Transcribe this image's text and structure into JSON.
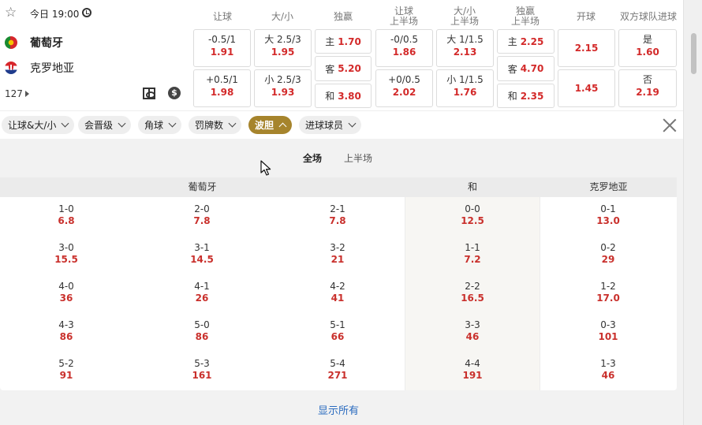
{
  "header": {
    "time": "今日 19:00",
    "more_count": "127"
  },
  "teams": {
    "home": "葡萄牙",
    "away": "克罗地亚"
  },
  "market_headers": [
    "让球",
    "大/小",
    "独赢",
    "让球\n上半场",
    "大/小\n上半场",
    "独赢\n上半场",
    "开球",
    "双方球队进球"
  ],
  "markets": {
    "handicap": [
      {
        "label": "-0.5/1",
        "odds": "1.91"
      },
      {
        "label": "+0.5/1",
        "odds": "1.98"
      }
    ],
    "total": [
      {
        "label": "大 2.5/3",
        "odds": "1.95"
      },
      {
        "label": "小 2.5/3",
        "odds": "1.93"
      }
    ],
    "moneyline": [
      {
        "label": "主",
        "odds": "1.70"
      },
      {
        "label": "客",
        "odds": "5.20"
      },
      {
        "label": "和",
        "odds": "3.80"
      }
    ],
    "handicap_1h": [
      {
        "label": "-0/0.5",
        "odds": "1.86"
      },
      {
        "label": "+0/0.5",
        "odds": "2.02"
      }
    ],
    "total_1h": [
      {
        "label": "大 1/1.5",
        "odds": "2.13"
      },
      {
        "label": "小 1/1.5",
        "odds": "1.76"
      }
    ],
    "moneyline_1h": [
      {
        "label": "主",
        "odds": "2.25"
      },
      {
        "label": "客",
        "odds": "4.70"
      },
      {
        "label": "和",
        "odds": "2.35"
      }
    ],
    "kickoff": [
      "2.15",
      "1.45"
    ],
    "btts": [
      {
        "label": "是",
        "odds": "1.60"
      },
      {
        "label": "否",
        "odds": "2.19"
      }
    ]
  },
  "filters": [
    "让球&大/小",
    "会晋级",
    "角球",
    "罚牌数",
    "波胆",
    "进球球员"
  ],
  "active_filter": "波胆",
  "period_tabs": [
    "全场",
    "上半场"
  ],
  "active_period": "全场",
  "score_grid": {
    "headers": {
      "home": "葡萄牙",
      "draw": "和",
      "away": "克罗地亚"
    },
    "rows": [
      [
        {
          "s": "1-0",
          "o": "6.8"
        },
        {
          "s": "2-0",
          "o": "7.8"
        },
        {
          "s": "2-1",
          "o": "7.8"
        },
        {
          "s": "0-0",
          "o": "12.5"
        },
        {
          "s": "0-1",
          "o": "13.0"
        }
      ],
      [
        {
          "s": "3-0",
          "o": "15.5"
        },
        {
          "s": "3-1",
          "o": "14.5"
        },
        {
          "s": "3-2",
          "o": "21"
        },
        {
          "s": "1-1",
          "o": "7.2"
        },
        {
          "s": "0-2",
          "o": "29"
        }
      ],
      [
        {
          "s": "4-0",
          "o": "36"
        },
        {
          "s": "4-1",
          "o": "26"
        },
        {
          "s": "4-2",
          "o": "41"
        },
        {
          "s": "2-2",
          "o": "16.5"
        },
        {
          "s": "1-2",
          "o": "17.0"
        }
      ],
      [
        {
          "s": "4-3",
          "o": "86"
        },
        {
          "s": "5-0",
          "o": "86"
        },
        {
          "s": "5-1",
          "o": "66"
        },
        {
          "s": "3-3",
          "o": "46"
        },
        {
          "s": "0-3",
          "o": "101"
        }
      ],
      [
        {
          "s": "5-2",
          "o": "91"
        },
        {
          "s": "5-3",
          "o": "161"
        },
        {
          "s": "5-4",
          "o": "271"
        },
        {
          "s": "4-4",
          "o": "191"
        },
        {
          "s": "1-3",
          "o": "46"
        }
      ]
    ]
  },
  "show_all": "显示所有",
  "colors": {
    "odds": "#d32a2a",
    "active_chip": "#a6842c",
    "link": "#2a6bbf"
  }
}
